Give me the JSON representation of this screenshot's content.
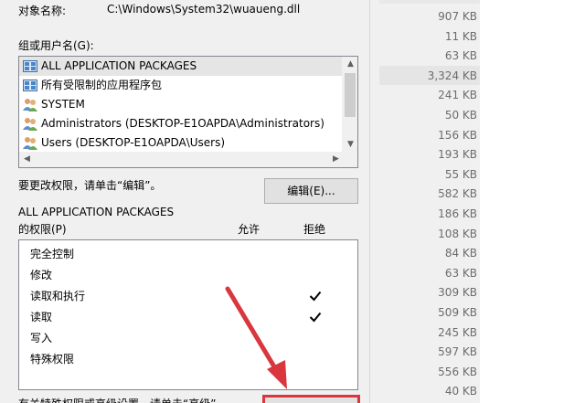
{
  "dialog": {
    "object_name_label": "对象名称:",
    "object_name_value": "C:\\Windows\\System32\\wuaueng.dll",
    "group_label": "组或用户名(G):",
    "principals": [
      {
        "label": "ALL APPLICATION PACKAGES",
        "icon": "package-icon",
        "selected": true
      },
      {
        "label": "所有受限制的应用程序包",
        "icon": "package-icon",
        "selected": false
      },
      {
        "label": "SYSTEM",
        "icon": "users-icon",
        "selected": false
      },
      {
        "label": "Administrators (DESKTOP-E1OAPDA\\Administrators)",
        "icon": "users-icon",
        "selected": false
      },
      {
        "label": "Users (DESKTOP-E1OAPDA\\Users)",
        "icon": "users-icon",
        "selected": false
      }
    ],
    "change_text": "要更改权限，请单击“编辑”。",
    "edit_button": "编辑(E)...",
    "perm_owner": "ALL APPLICATION PACKAGES",
    "perm_of": "的权限(P)",
    "allow_header": "允许",
    "deny_header": "拒绝",
    "permissions": [
      {
        "label": "完全控制",
        "allow": false
      },
      {
        "label": "修改",
        "allow": false
      },
      {
        "label": "读取和执行",
        "allow": true
      },
      {
        "label": "读取",
        "allow": true
      },
      {
        "label": "写入",
        "allow": false
      },
      {
        "label": "特殊权限",
        "allow": false
      }
    ],
    "bottom_text": "有关特殊权限或高级设置，请单击“高级”。"
  },
  "explorer": {
    "sizes": [
      "907 KB",
      "11 KB",
      "63 KB",
      "3,324 KB",
      "241 KB",
      "50 KB",
      "156 KB",
      "193 KB",
      "55 KB",
      "582 KB",
      "186 KB",
      "108 KB",
      "84 KB",
      "63 KB",
      "309 KB",
      "509 KB",
      "245 KB",
      "597 KB",
      "556 KB",
      "40 KB"
    ]
  },
  "colors": {
    "annotation_red": "#d9363e",
    "selection": "#e5e5e5"
  }
}
